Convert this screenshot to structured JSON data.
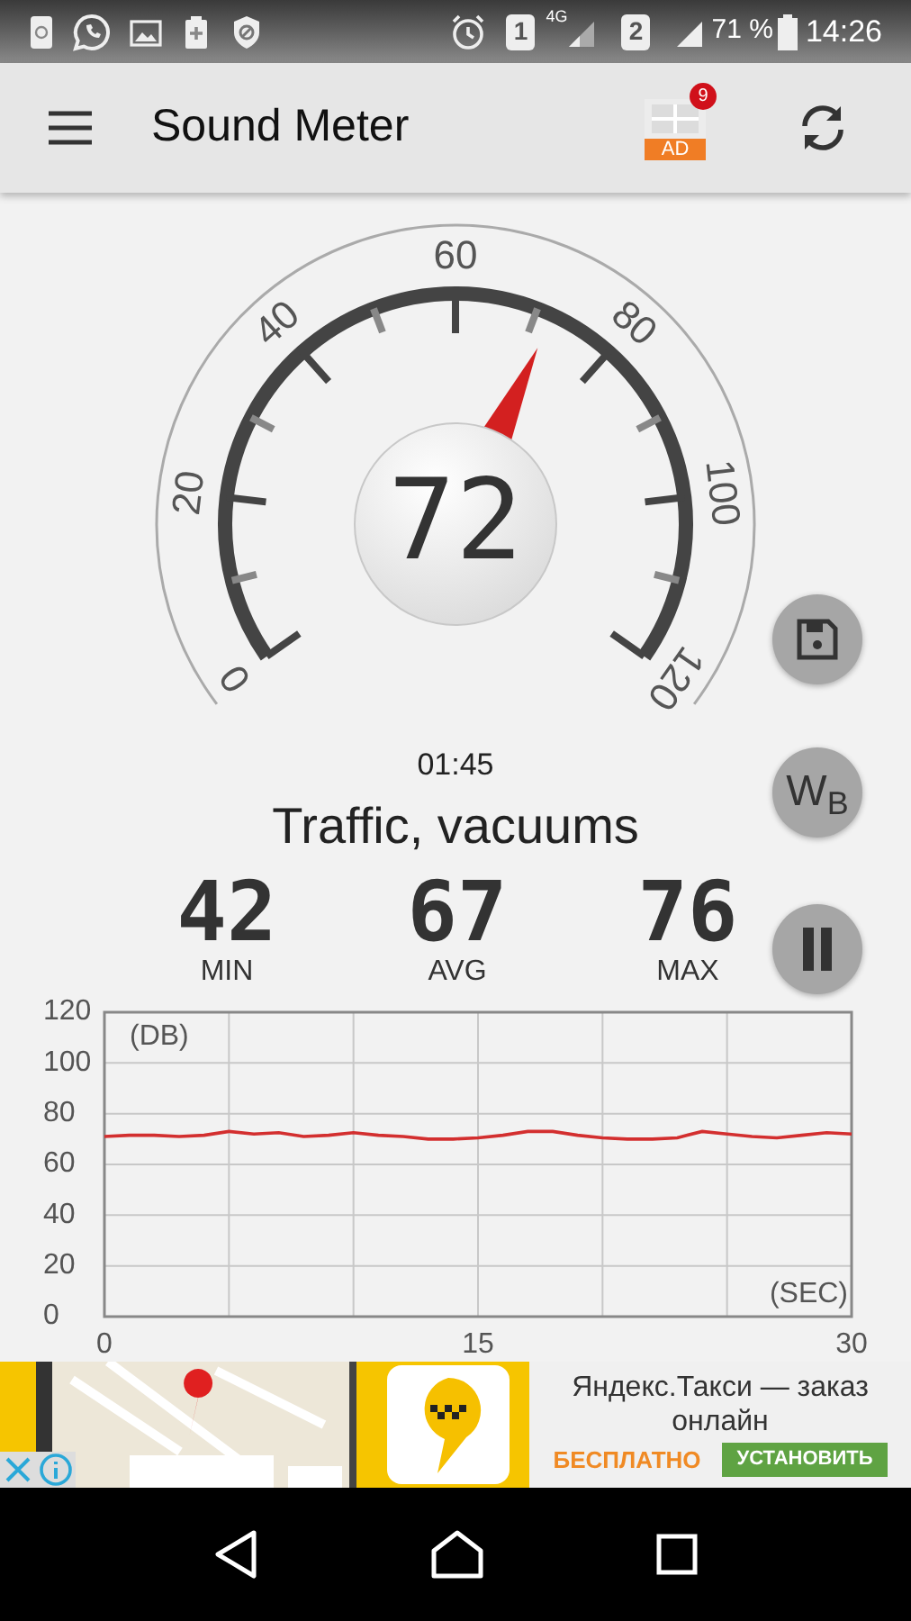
{
  "status_bar": {
    "sim_1": "1",
    "network": "4G",
    "sim_2": "2",
    "battery": "71 %",
    "time": "14:26"
  },
  "app_bar": {
    "title": "Sound Meter",
    "ad_badge": "9",
    "ad_label": "AD"
  },
  "gauge": {
    "scale_labels": [
      "0",
      "20",
      "40",
      "60",
      "80",
      "100",
      "120"
    ],
    "reading": "72"
  },
  "elapsed": "01:45",
  "description": "Traffic, vacuums",
  "stats": [
    {
      "value": "42",
      "label": "MIN"
    },
    {
      "value": "67",
      "label": "AVG"
    },
    {
      "value": "76",
      "label": "MAX"
    }
  ],
  "side_buttons": [
    {
      "kind": "save"
    },
    {
      "kind": "wb",
      "label": "W$_{B}$"
    },
    {
      "kind": "pause"
    }
  ],
  "chart": {
    "chart_data": {
      "type": "line",
      "xlabel": "(SEC)",
      "ylabel": "(DB)",
      "x": [
        0,
        1,
        2,
        3,
        4,
        5,
        6,
        7,
        8,
        9,
        10,
        11,
        12,
        13,
        14,
        15,
        16,
        17,
        18,
        19,
        20,
        21,
        22,
        23,
        24,
        25,
        26,
        27,
        28,
        29,
        30
      ],
      "grid": true,
      "series": [
        {
          "color": "#d32f2f",
          "values": [
            71,
            71.5,
            71.5,
            71,
            71.5,
            73,
            72,
            72.5,
            71,
            71.5,
            72.5,
            71.5,
            71,
            70,
            70,
            70.5,
            71.5,
            73,
            73,
            71.5,
            70.5,
            70,
            70,
            70.5,
            73,
            72,
            71,
            70.5,
            71.5,
            72.5,
            72
          ]
        }
      ],
      "xlim": [
        0,
        30
      ],
      "ylim": [
        0,
        120
      ],
      "xticks": [
        0,
        15,
        30
      ],
      "yticks": [
        0,
        20,
        40,
        60,
        80,
        100,
        120
      ]
    }
  },
  "ad_banner": {
    "kind": "picture",
    "headline": "Яндекс.Такси — заказ онлайн",
    "price": "БЕСПЛАТНО",
    "install": "УСТАНОВИТЬ"
  }
}
